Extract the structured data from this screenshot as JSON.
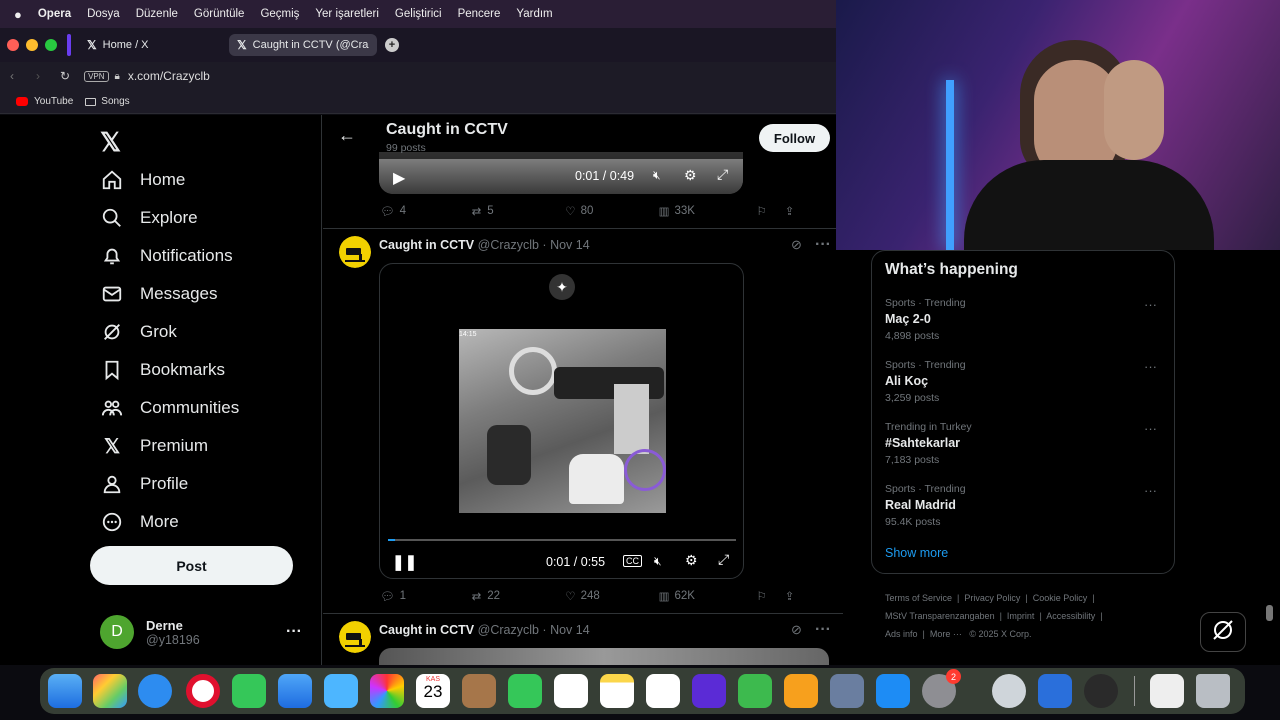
{
  "menubar": {
    "app": "Opera",
    "items": [
      "Dosya",
      "Düzenle",
      "Görüntüle",
      "Geçmiş",
      "Yer işaretleri",
      "Geliştirici",
      "Pencere",
      "Yardım"
    ]
  },
  "tabs": [
    {
      "label": "Home / X"
    },
    {
      "label": "Caught in CCTV (@Craz"
    }
  ],
  "address": {
    "vpn": "VPN",
    "url": "x.com/Crazyclb"
  },
  "bookmarks": [
    {
      "label": "YouTube"
    },
    {
      "label": "Songs"
    }
  ],
  "nav": {
    "items": [
      {
        "label": "Home",
        "icon": "home-icon"
      },
      {
        "label": "Explore",
        "icon": "search-icon"
      },
      {
        "label": "Notifications",
        "icon": "bell-icon"
      },
      {
        "label": "Messages",
        "icon": "mail-icon"
      },
      {
        "label": "Grok",
        "icon": "grok-icon"
      },
      {
        "label": "Bookmarks",
        "icon": "bookmark-icon"
      },
      {
        "label": "Communities",
        "icon": "people-icon"
      },
      {
        "label": "Premium",
        "icon": "x-logo-icon"
      },
      {
        "label": "Profile",
        "icon": "person-icon"
      },
      {
        "label": "More",
        "icon": "more-circle-icon"
      }
    ],
    "post_label": "Post",
    "account": {
      "initial": "D",
      "name": "Derne",
      "handle": "@y18196"
    }
  },
  "header": {
    "title": "Caught in CCTV",
    "subtitle": "99 posts",
    "follow_label": "Follow"
  },
  "tweet1": {
    "video_time": "0:01 / 0:49",
    "replies": "4",
    "reposts": "5",
    "likes": "80",
    "views": "33K"
  },
  "tweet2": {
    "name": "Caught in CCTV",
    "handle": "@Crazyclb",
    "date": "Nov 14",
    "video_timestamp": "14:15",
    "video_time": "0:01 / 0:55",
    "replies": "1",
    "reposts": "22",
    "likes": "248",
    "views": "62K"
  },
  "tweet3": {
    "name": "Caught in CCTV",
    "handle": "@Crazyclb",
    "date": "Nov 14"
  },
  "trends": {
    "title": "What’s happening",
    "items": [
      {
        "meta": "Sports · Trending",
        "title": "Maç 2-0",
        "posts": "4,898 posts"
      },
      {
        "meta": "Sports · Trending",
        "title": "Ali Koç",
        "posts": "3,259 posts"
      },
      {
        "meta": "Trending in Turkey",
        "title": "#Sahtekarlar",
        "posts": "7,183 posts"
      },
      {
        "meta": "Sports · Trending",
        "title": "Real Madrid",
        "posts": "95.4K posts"
      }
    ],
    "show_more": "Show more"
  },
  "footer": {
    "links": [
      "Terms of Service",
      "Privacy Policy",
      "Cookie Policy",
      "MStV Transparenzangaben",
      "Imprint",
      "Accessibility",
      "Ads info",
      "More ···"
    ],
    "copyright": "© 2025 X Corp."
  },
  "dock": {
    "calendar_month": "KAS",
    "calendar_day": "23",
    "settings_badge": "2"
  },
  "colors": {
    "accent": "#1d9bf0",
    "background": "#000000",
    "text": "#e7e9ea",
    "muted": "#71767b"
  }
}
